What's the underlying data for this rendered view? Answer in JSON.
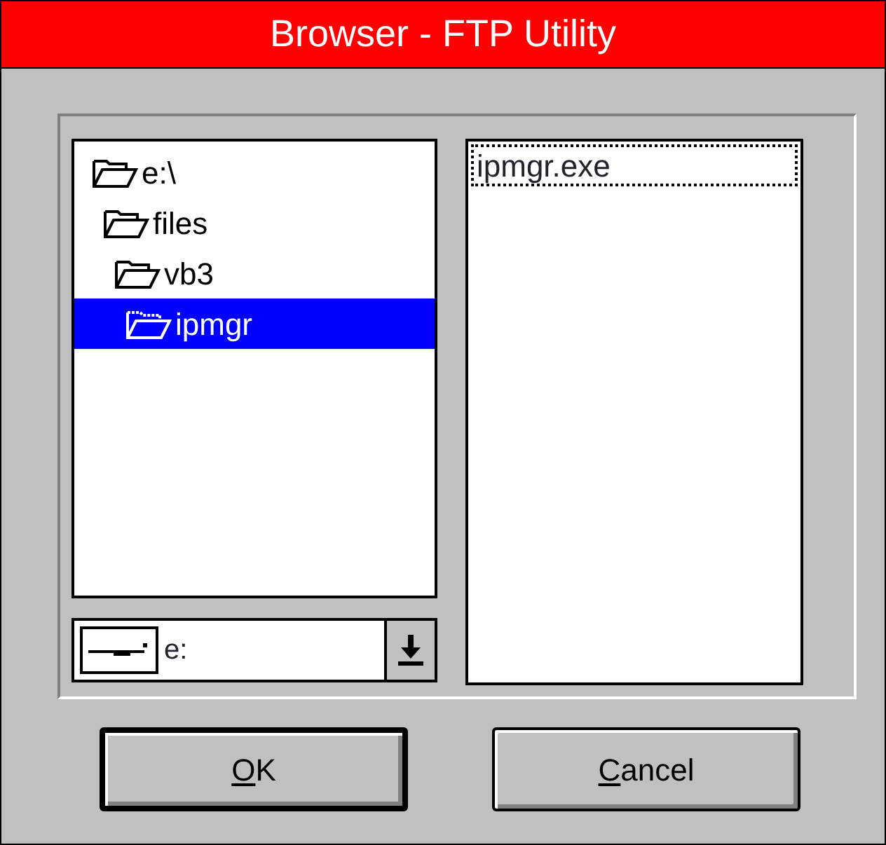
{
  "window": {
    "title": "Browser - FTP Utility"
  },
  "directories": [
    {
      "name": "e:\\",
      "open": true,
      "selected": false,
      "children": [
        {
          "name": "files",
          "open": true,
          "selected": false,
          "children": [
            {
              "name": "vb3",
              "open": true,
              "selected": false,
              "children": [
                {
                  "name": "ipmgr",
                  "open": true,
                  "selected": true
                }
              ]
            }
          ]
        }
      ]
    }
  ],
  "drive": {
    "value": "e:"
  },
  "files": [
    {
      "name": "ipmgr.exe",
      "focused": true
    }
  ],
  "buttons": [
    {
      "label": "OK",
      "default": true,
      "mnemonic_underlined": true
    },
    {
      "label": "Cancel",
      "default": false,
      "mnemonic_underlined": true
    }
  ]
}
